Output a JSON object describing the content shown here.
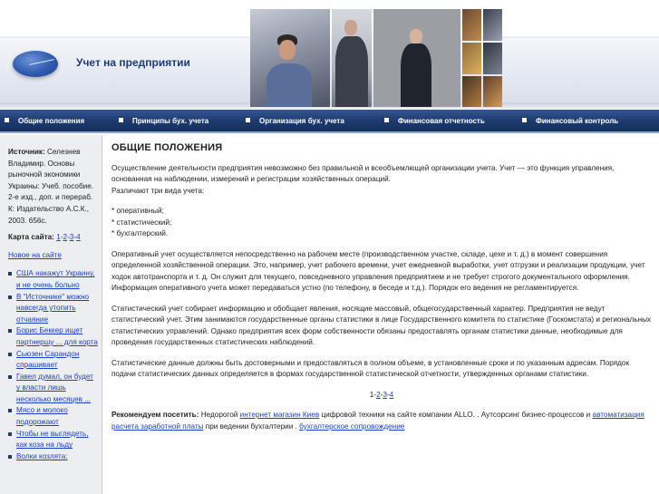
{
  "header": {
    "site_title": "Учет на предприятии"
  },
  "nav": {
    "items": [
      {
        "label": "Общие положения"
      },
      {
        "label": "Принципы бух. учета"
      },
      {
        "label": "Организация бух. учета"
      },
      {
        "label": "Финансовая отчетность"
      },
      {
        "label": "Финансовый контроль"
      }
    ]
  },
  "sidebar": {
    "source_label": "Источник:",
    "source_text": "Селезнев Владимир. Основы рыночной экономики Украины: Учеб. пособие. 2-е изд., доп. и перераб. К: Издательство А.С.К., 2003. 656с.",
    "map_label": "Карта сайта:",
    "map_pages": [
      "1",
      "2",
      "3",
      "4"
    ],
    "map_sep": "-",
    "new_link": "Новое на сайте",
    "news": [
      {
        "text": "США накажут Украину, и не очень больно"
      },
      {
        "text": "В \"Источнике\" можно навсегда утопить отчаяние"
      },
      {
        "text": "Борис Беккер ищет партнершу ... для корта"
      },
      {
        "text": "Сьюзен Сарандон спрашивает"
      },
      {
        "text": "Гавел думал, он будет у власти лишь несколько месяцев ..."
      },
      {
        "text": "Мясо и молоко подорожают"
      },
      {
        "text": "Чтобы не выглядеть, как коза на льду"
      },
      {
        "text": "Волки козлята:"
      }
    ]
  },
  "main": {
    "title": "ОБЩИЕ ПОЛОЖЕНИЯ",
    "para1": "Осуществление деятельности предприятия невозможно без правильной и всеобъемлющей организации учета. Учет — это функция управления, основанная на наблюдении, измерений и регистрации хозяйственных операций.",
    "para1b": "Различают три вида учета:",
    "types": [
      "* оперативный;",
      "* статистический;",
      "* бухгалтерский."
    ],
    "para2": "Оперативный учет осуществляется непосредственно на рабочем месте (производственном участке, складе, цехе и т. д.) в момент совершения определенной хозяйственной операции. Это, например, учет рабочего времени, учет ежедневной выработки, учет отгрузки и реализации продукции, учет ходок автотранспорта и т. д. Он служит для текущего, повседневного управления предприятием и не требует строгого документального оформления. Информация оперативного учета может передаваться устно (по телефону, в беседе и т.д.). Порядок его ведения не регламентируется.",
    "para3": "Статистический учет собирает информацию и обобщает явления, носящие массовый, общегосударственный характер. Предприятия не ведут статистический учет. Этим занимаются государственные органы статистики в лице Государственного комитета по статистике (Госкомстата) и региональных статистических управлений. Однако предприятия всех форм собственности обязаны предоставлять органам статистики данные, необходимые для проведения государственных статистических наблюдений.",
    "para4": "Статистические данные должны быть достоверными и предоставляться в полном объеме, в установленные сроки и по указанным адресам. Порядок подачи статистических данных определяется в формах государственной статистической отчетности, утвержденных органами статистики.",
    "pager_current": "1",
    "pager_links": [
      "2",
      "3",
      "4"
    ],
    "pager_sep": "-",
    "recommend": {
      "label": "Рекомендуем посетить:",
      "t1": "Недорогой",
      "link1": "интернет магазин Киев",
      "t2": "цифровой техники на сайте компании ALLO. . Аутсорсинг бизнес-процессов и",
      "link2": "автоматизация расчета заработной платы",
      "t3": "при ведении бухгалтерии .",
      "link3": "бухгалтерское сопровождение"
    }
  }
}
